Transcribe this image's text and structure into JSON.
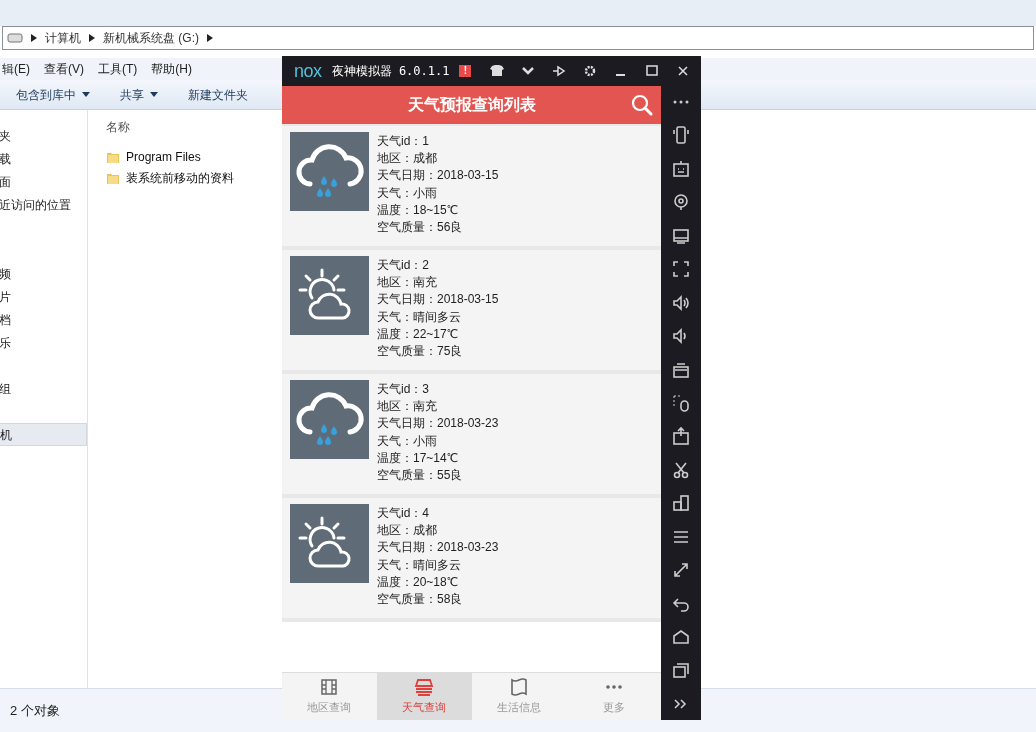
{
  "explorer": {
    "address": [
      "计算机",
      "新机械系统盘 (G:)"
    ],
    "menu": [
      "辑(E)",
      "查看(V)",
      "工具(T)",
      "帮助(H)"
    ],
    "toolbar": [
      {
        "label": "包含到库中",
        "has_caret": true
      },
      {
        "label": "共享",
        "has_caret": true
      },
      {
        "label": "新建文件夹",
        "has_caret": false
      }
    ],
    "nav_items": [
      {
        "label": "夹",
        "selected": false
      },
      {
        "label": "载",
        "selected": false
      },
      {
        "label": "面",
        "selected": false
      },
      {
        "label": "近访问的位置",
        "selected": false
      },
      {
        "label": "频",
        "selected": false
      },
      {
        "label": "片",
        "selected": false
      },
      {
        "label": "档",
        "selected": false
      },
      {
        "label": "乐",
        "selected": false
      },
      {
        "label": "组",
        "selected": false
      },
      {
        "label": "机",
        "selected": true
      }
    ],
    "column_header": "名称",
    "files": [
      "Program Files",
      "装系统前移动的资料"
    ],
    "status": "2 个对象"
  },
  "emulator": {
    "logo": "nox",
    "title": "夜神模拟器 6.0.1.1",
    "alert": "!",
    "app_title": "天气预报查询列表",
    "records": [
      {
        "kind": "rain",
        "lines": [
          "天气id：1",
          "地区：成都",
          "天气日期：2018-03-15",
          "天气：小雨",
          "温度：18~15℃",
          "空气质量：56良"
        ]
      },
      {
        "kind": "sun-cloud",
        "lines": [
          "天气id：2",
          "地区：南充",
          "天气日期：2018-03-15",
          "天气：晴间多云",
          "温度：22~17℃",
          "空气质量：75良"
        ]
      },
      {
        "kind": "rain",
        "lines": [
          "天气id：3",
          "地区：南充",
          "天气日期：2018-03-23",
          "天气：小雨",
          "温度：17~14℃",
          "空气质量：55良"
        ]
      },
      {
        "kind": "sun-cloud",
        "lines": [
          "天气id：4",
          "地区：成都",
          "天气日期：2018-03-23",
          "天气：晴间多云",
          "温度：20~18℃",
          "空气质量：58良"
        ]
      }
    ],
    "tabs": [
      {
        "kind": "film",
        "label": "地区查询",
        "selected": false
      },
      {
        "kind": "tray",
        "label": "天气查询",
        "selected": true
      },
      {
        "kind": "map",
        "label": "生活信息",
        "selected": false
      },
      {
        "kind": "dots",
        "label": "更多",
        "selected": false
      }
    ]
  }
}
